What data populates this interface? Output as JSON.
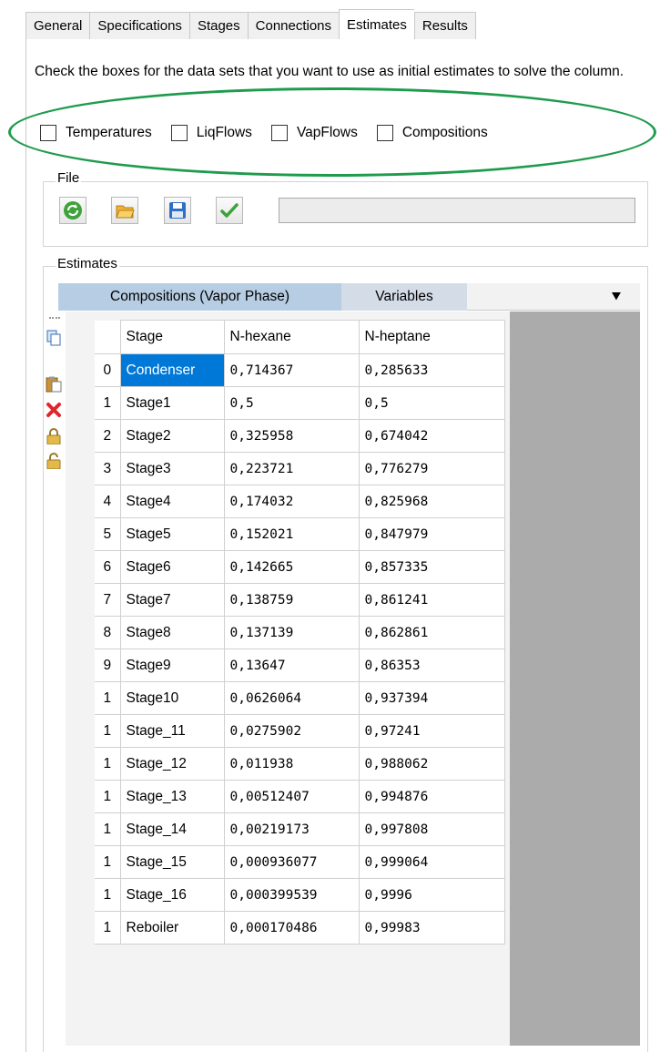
{
  "tabs": [
    "General",
    "Specifications",
    "Stages",
    "Connections",
    "Estimates",
    "Results"
  ],
  "active_tab": "Estimates",
  "instruction": "Check the boxes for the data sets that you want to use as initial estimates to solve the column.",
  "checkboxes": [
    "Temperatures",
    "LiqFlows",
    "VapFlows",
    "Compositions"
  ],
  "file_group": {
    "label": "File"
  },
  "estimates_group": {
    "label": "Estimates"
  },
  "inner_tabs": {
    "selected": "Compositions (Vapor Phase)",
    "other": "Variables",
    "menu_glyph": "⯆"
  },
  "grid": {
    "headers": [
      "Stage",
      "N-hexane",
      "N-heptane"
    ],
    "rows": [
      {
        "idx": "0",
        "stage": "Condenser",
        "hexane": "0,714367",
        "heptane": "0,285633"
      },
      {
        "idx": "1",
        "stage": "Stage1",
        "hexane": "0,5",
        "heptane": "0,5"
      },
      {
        "idx": "2",
        "stage": "Stage2",
        "hexane": "0,325958",
        "heptane": "0,674042"
      },
      {
        "idx": "3",
        "stage": "Stage3",
        "hexane": "0,223721",
        "heptane": "0,776279"
      },
      {
        "idx": "4",
        "stage": "Stage4",
        "hexane": "0,174032",
        "heptane": "0,825968"
      },
      {
        "idx": "5",
        "stage": "Stage5",
        "hexane": "0,152021",
        "heptane": "0,847979"
      },
      {
        "idx": "6",
        "stage": "Stage6",
        "hexane": "0,142665",
        "heptane": "0,857335"
      },
      {
        "idx": "7",
        "stage": "Stage7",
        "hexane": "0,138759",
        "heptane": "0,861241"
      },
      {
        "idx": "8",
        "stage": "Stage8",
        "hexane": "0,137139",
        "heptane": "0,862861"
      },
      {
        "idx": "9",
        "stage": "Stage9",
        "hexane": "0,13647",
        "heptane": "0,86353"
      },
      {
        "idx": "1",
        "stage": "Stage10",
        "hexane": "0,0626064",
        "heptane": "0,937394"
      },
      {
        "idx": "1",
        "stage": "Stage_11",
        "hexane": "0,0275902",
        "heptane": "0,97241"
      },
      {
        "idx": "1",
        "stage": "Stage_12",
        "hexane": "0,011938",
        "heptane": "0,988062"
      },
      {
        "idx": "1",
        "stage": "Stage_13",
        "hexane": "0,00512407",
        "heptane": "0,994876"
      },
      {
        "idx": "1",
        "stage": "Stage_14",
        "hexane": "0,00219173",
        "heptane": "0,997808"
      },
      {
        "idx": "1",
        "stage": "Stage_15",
        "hexane": "0,000936077",
        "heptane": "0,999064"
      },
      {
        "idx": "1",
        "stage": "Stage_16",
        "hexane": "0,000399539",
        "heptane": "0,9996"
      },
      {
        "idx": "1",
        "stage": "Reboiler",
        "hexane": "0,000170486",
        "heptane": "0,99983"
      }
    ]
  },
  "toolbar_icons": [
    "refresh-icon",
    "open-folder-icon",
    "save-icon",
    "checkmark-icon"
  ],
  "strip_icons": [
    "copy-icon",
    "paste-icon",
    "delete-icon",
    "lock-icon",
    "unlock-icon"
  ],
  "colors": {
    "highlight_ellipse": "#1f9b4d",
    "selected_cell": "#0078d7",
    "selected_tab": "#b7cde3"
  }
}
